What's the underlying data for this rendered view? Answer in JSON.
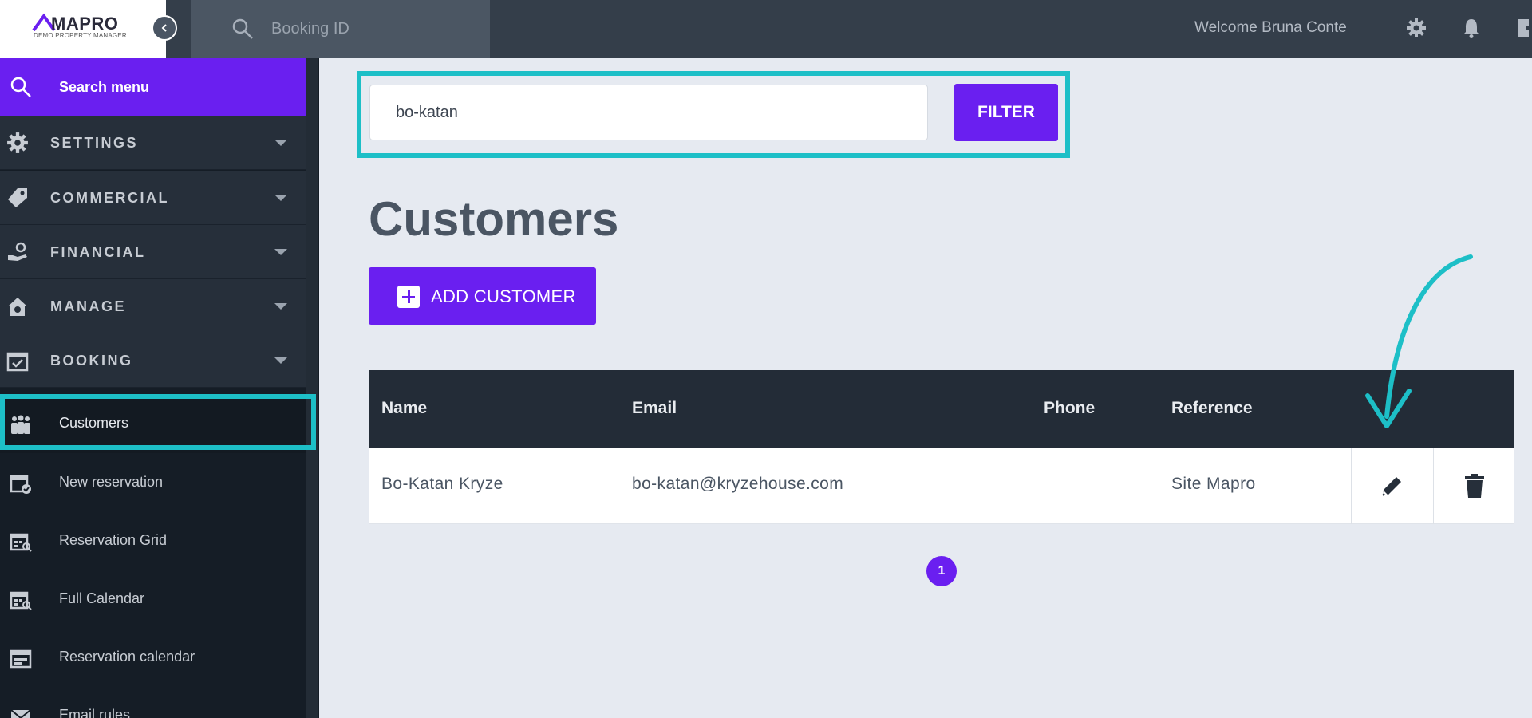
{
  "brand": {
    "name": "MAPRO",
    "subtitle": "DEMO PROPERTY MANAGER"
  },
  "topbar": {
    "search_placeholder": "Booking ID",
    "welcome": "Welcome Bruna Conte",
    "icons": [
      "gear-icon",
      "bell-icon",
      "logout-icon"
    ]
  },
  "sidebar": {
    "search_label": "Search menu",
    "sections": [
      {
        "label": "SETTINGS",
        "icon": "gear-icon"
      },
      {
        "label": "COMMERCIAL",
        "icon": "tag-icon"
      },
      {
        "label": "FINANCIAL",
        "icon": "hand-coin-icon"
      },
      {
        "label": "MANAGE",
        "icon": "house-gear-icon"
      },
      {
        "label": "BOOKING",
        "icon": "calendar-check-icon"
      }
    ],
    "items": [
      {
        "label": "Customers",
        "icon": "people-icon",
        "active": true
      },
      {
        "label": "New reservation",
        "icon": "calendar-plus-icon"
      },
      {
        "label": "Reservation Grid",
        "icon": "calendar-grid-icon"
      },
      {
        "label": "Full Calendar",
        "icon": "calendar-search-icon"
      },
      {
        "label": "Reservation calendar",
        "icon": "calendar-list-icon"
      },
      {
        "label": "Email rules",
        "icon": "envelope-icon"
      }
    ]
  },
  "filter": {
    "value": "bo-katan",
    "button_label": "FILTER"
  },
  "page": {
    "title": "Customers",
    "add_button_label": "ADD CUSTOMER"
  },
  "table": {
    "columns": [
      "Name",
      "Email",
      "Phone",
      "Reference"
    ],
    "rows": [
      {
        "name": "Bo-Katan Kryze",
        "email": "bo-katan@kryzehouse.com",
        "phone": "",
        "reference": "Site Mapro"
      }
    ]
  },
  "pagination": {
    "current": "1"
  },
  "colors": {
    "accent": "#6a1ff0",
    "highlight": "#1dbfc7",
    "sidebar": "#151d26",
    "topbar": "#343e4a"
  }
}
